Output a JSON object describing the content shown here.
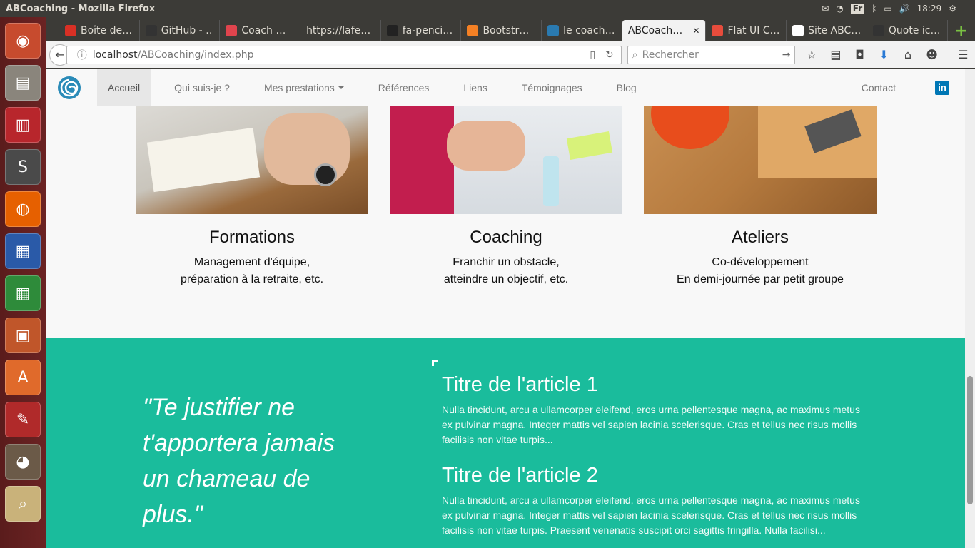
{
  "window": {
    "title": "ABCoaching - Mozilla Firefox"
  },
  "system": {
    "keyboard": "Fr",
    "clock": "18:29"
  },
  "tabs": [
    {
      "label": "Boîte de…",
      "icon": "gmail-icon",
      "color": "#d93025"
    },
    {
      "label": "GitHub - …",
      "icon": "github-icon",
      "color": "#333333"
    },
    {
      "label": "Coach …",
      "icon": "star-icon",
      "color": "#e0444d"
    },
    {
      "label": "https://lafe…",
      "icon": "",
      "color": ""
    },
    {
      "label": "fa-penci…",
      "icon": "flag-icon",
      "color": "#222222"
    },
    {
      "label": "Bootstr…",
      "icon": "stack-icon",
      "color": "#f48024"
    },
    {
      "label": "le coach…",
      "icon": "dev-icon",
      "color": "#2a7ab0"
    },
    {
      "label": "ABCoach…",
      "icon": "",
      "color": "",
      "active": true
    },
    {
      "label": "Flat UI C…",
      "icon": "grid-icon",
      "color": "#e74c3c"
    },
    {
      "label": "Site ABC…",
      "icon": "h-icon",
      "color": "#ffffff"
    },
    {
      "label": "Quote ic…",
      "icon": "quote-icon",
      "color": "#333333"
    }
  ],
  "address": {
    "host": "localhost",
    "path": "/ABCoaching/index.php"
  },
  "search": {
    "placeholder": "Rechercher"
  },
  "site": {
    "nav": [
      {
        "label": "Accueil",
        "active": true
      },
      {
        "label": "Qui suis-je ?"
      },
      {
        "label": "Mes prestations",
        "dropdown": true
      },
      {
        "label": "Références"
      },
      {
        "label": "Liens"
      },
      {
        "label": "Témoignages"
      },
      {
        "label": "Blog"
      }
    ],
    "contact": "Contact",
    "linkedin": "in",
    "cards": [
      {
        "title": "Formations",
        "line1": "Management d'équipe,",
        "line2": "préparation à la retraite, etc."
      },
      {
        "title": "Coaching",
        "line1": "Franchir un obstacle,",
        "line2": "atteindre un objectif, etc."
      },
      {
        "title": "Ateliers",
        "line1": "Co-développement",
        "line2": "En demi-journée par petit groupe"
      }
    ],
    "quote": "\"Te justifier ne t'apportera jamais un chameau de plus.\"",
    "articles": [
      {
        "title": "Titre de l'article 1",
        "body": "Nulla tincidunt, arcu a ullamcorper eleifend, eros urna pellentesque magna, ac maximus metus ex pulvinar magna. Integer mattis vel sapien lacinia scelerisque. Cras et tellus nec risus mollis facilisis non vitae turpis..."
      },
      {
        "title": "Titre de l'article 2",
        "body": "Nulla tincidunt, arcu a ullamcorper eleifend, eros urna pellentesque magna, ac maximus metus ex pulvinar magna. Integer mattis vel sapien lacinia scelerisque. Cras et tellus nec risus mollis facilisis non vitae turpis. Praesent venenatis suscipit orci sagittis fringilla. Nulla facilisi..."
      }
    ]
  },
  "colors": {
    "accent": "#1abc9c",
    "launcher": "#6b2323"
  }
}
